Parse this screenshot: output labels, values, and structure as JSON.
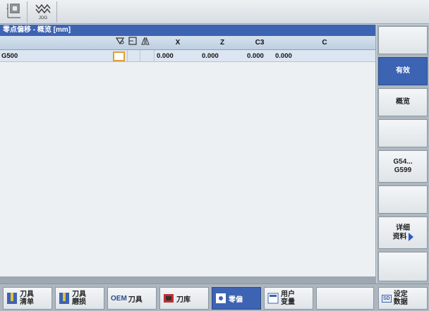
{
  "topbar": {
    "jog_label": "JOG"
  },
  "title": "零点偏移 - 概览 [mm]",
  "table": {
    "headers": [
      "X",
      "Z",
      "C3",
      "C"
    ],
    "rows": [
      {
        "name": "G500",
        "x": "0.000",
        "z": "0.000",
        "c3": "0.000",
        "c": "0.000"
      }
    ]
  },
  "softkeys_right": [
    {
      "label": ""
    },
    {
      "label": "有效",
      "active": true
    },
    {
      "label": "概览"
    },
    {
      "label": ""
    },
    {
      "label": "G54...\nG599"
    },
    {
      "label": ""
    },
    {
      "label": "详细\n资料"
    },
    {
      "label": ""
    }
  ],
  "softkeys_bottom": [
    {
      "line1": "刀具",
      "line2": "清单"
    },
    {
      "line1": "刀具",
      "line2": "磨损"
    },
    {
      "prefix": "OEM",
      "line1": "刀具"
    },
    {
      "line1": "刀库"
    },
    {
      "line1": "零偏",
      "active": true
    },
    {
      "line1": "用户",
      "line2": "变量"
    },
    {
      "line1": ""
    },
    {
      "prefix": "SD",
      "line1": "设定",
      "line2": "数据"
    }
  ],
  "colors": {
    "accent": "#3d63b3",
    "selection": "#e0a030"
  }
}
